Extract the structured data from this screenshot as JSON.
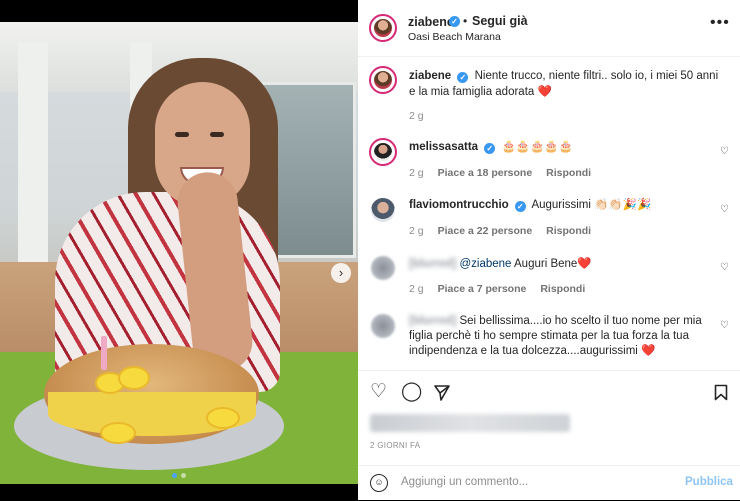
{
  "post": {
    "author": "ziabene",
    "follow_label": "Segui già",
    "location": "Oasi Beach Marana",
    "caption": "Niente trucco, niente filtri.. solo io, i miei 50 anni e la mia famiglia adorata ❤️",
    "caption_time": "2 g",
    "post_time": "2 GIORNI FA",
    "more_label": "•••"
  },
  "comments": [
    {
      "user": "melissasatta",
      "text": "🎂🎂🎂🎂🎂",
      "time": "2 g",
      "likes": "Piace a 18 persone",
      "reply": "Rispondi"
    },
    {
      "user": "flaviomontrucchio",
      "text": "Augurissimi 👏🏻👏🏻🎉🎉",
      "time": "2 g",
      "likes": "Piace a 22 persone",
      "reply": "Rispondi"
    },
    {
      "user": "[blurred]",
      "mention": "@ziabene",
      "text": "Auguri Bene❤️",
      "time": "2 g",
      "likes": "Piace a 7 persone",
      "reply": "Rispondi"
    },
    {
      "user": "[blurred]",
      "text": "Sei bellissima....io ho scelto il tuo nome per mia figlia perchè ti ho sempre stimata per la tua forza la tua indipendenza e la tua dolcezza....augurissimi ❤️"
    }
  ],
  "composer": {
    "placeholder": "Aggiungi un commento...",
    "publish_label": "Pubblica"
  },
  "icons": {
    "like": "heart-icon",
    "comment": "comment-icon",
    "share": "paper-plane-icon",
    "save": "bookmark-icon",
    "emoji": "emoji-icon",
    "next": "chevron-right-icon",
    "verified": "verified-badge-icon"
  },
  "colors": {
    "accent": "#3897f0",
    "publish": "#8ec5f5",
    "text": "#262626",
    "muted": "#8e8e8e"
  }
}
